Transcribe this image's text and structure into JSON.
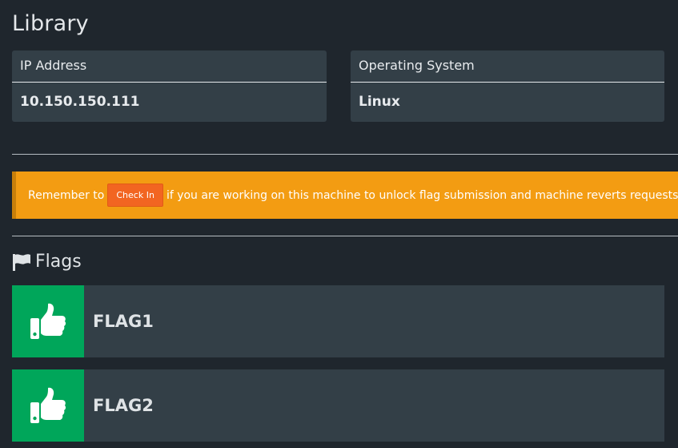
{
  "page": {
    "title": "Library"
  },
  "info": {
    "ip": {
      "label": "IP Address",
      "value": "10.150.150.111"
    },
    "os": {
      "label": "Operating System",
      "value": "Linux"
    }
  },
  "alert": {
    "prefix": "Remember to",
    "button_label": "Check In",
    "suffix": "if you are working on this machine to unlock flag submission and machine reverts requests",
    "color": "#f39c12"
  },
  "flags": {
    "section_icon": "flag-icon",
    "section_title": "Flags",
    "items": [
      {
        "name": "FLAG1",
        "status_icon": "thumbs-up-icon",
        "status_color": "#00a65a"
      },
      {
        "name": "FLAG2",
        "status_icon": "thumbs-up-icon",
        "status_color": "#00a65a"
      }
    ]
  }
}
